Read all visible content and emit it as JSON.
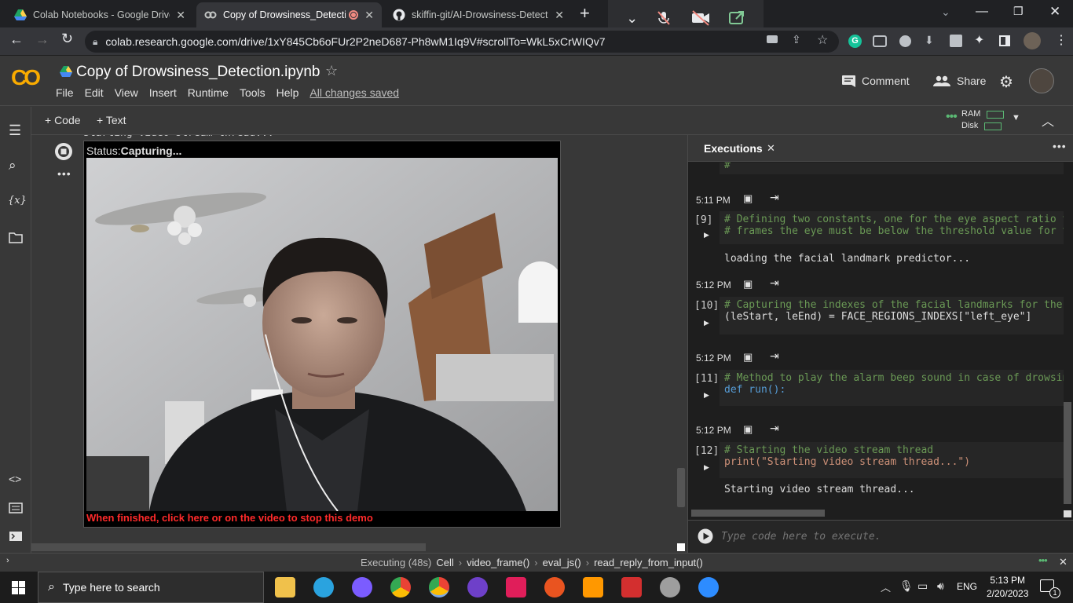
{
  "browser": {
    "tabs": [
      {
        "title": "Colab Notebooks - Google Drive",
        "icon": "google-drive-icon"
      },
      {
        "title": "Copy of Drowsiness_Detectio",
        "icon": "colab-icon",
        "active": true
      },
      {
        "title": "skiffin-git/AI-Drowsiness-Detecti",
        "icon": "github-icon"
      }
    ],
    "url": "colab.research.google.com/drive/1xY845Cb6oFUr2P2neD687-Ph8wM1Iq9V#scrollTo=WkL5xCrWIQv7"
  },
  "colab": {
    "logo": "CO",
    "title": "Copy of Drowsiness_Detection.ipynb",
    "menu": [
      "File",
      "Edit",
      "View",
      "Insert",
      "Runtime",
      "Tools",
      "Help"
    ],
    "saved": "All changes saved",
    "comment": "Comment",
    "share": "Share",
    "add_code": "+ Code",
    "add_text": "+ Text",
    "ram": "RAM",
    "disk": "Disk"
  },
  "notebook": {
    "truncated_line": "Starting video stream thread...",
    "status_label": "Status:",
    "status_value": "Capturing...",
    "finish_msg": "When finished, click here or on the video to stop this demo"
  },
  "executions": {
    "title": "Executions",
    "entries": [
      {
        "time": "5:11 PM",
        "label": "[9]",
        "lines": [
          "# Defining two constants, one for the eye aspect ratio t",
          "# frames the eye must be below the threshold value for t"
        ],
        "output": "loading the facial landmark predictor..."
      },
      {
        "time": "5:12 PM",
        "label": "[10]",
        "lines": [
          "# Capturing the indexes of the facial landmarks for the",
          "(leStart, leEnd) = FACE_REGIONS_INDEXS[\"left_eye\"]"
        ],
        "output": ""
      },
      {
        "time": "5:12 PM",
        "label": "[11]",
        "lines": [
          "# Method to play the alarm beep sound in case of drowsin",
          "def run():"
        ],
        "output": ""
      },
      {
        "time": "5:12 PM",
        "label": "[12]",
        "lines": [
          "# Starting the video stream thread",
          "print(\"Starting video stream thread...\")"
        ],
        "output": "Starting video stream thread..."
      }
    ],
    "placeholder": "Type code here to execute."
  },
  "statusbar": {
    "executing": "Executing (48s)",
    "crumbs": [
      "Cell",
      "video_frame()",
      "eval_js()",
      "read_reply_from_input()"
    ]
  },
  "taskbar": {
    "search": "Type here to search",
    "lang": "ENG",
    "time": "5:13 PM",
    "date": "2/20/2023",
    "notif": "1"
  },
  "colors": {
    "accent": "#f9ab00",
    "error_red": "#ff2a2a",
    "comment_green": "#6a9955",
    "keyword_blue": "#569cd6",
    "string_orange": "#ce9178"
  }
}
